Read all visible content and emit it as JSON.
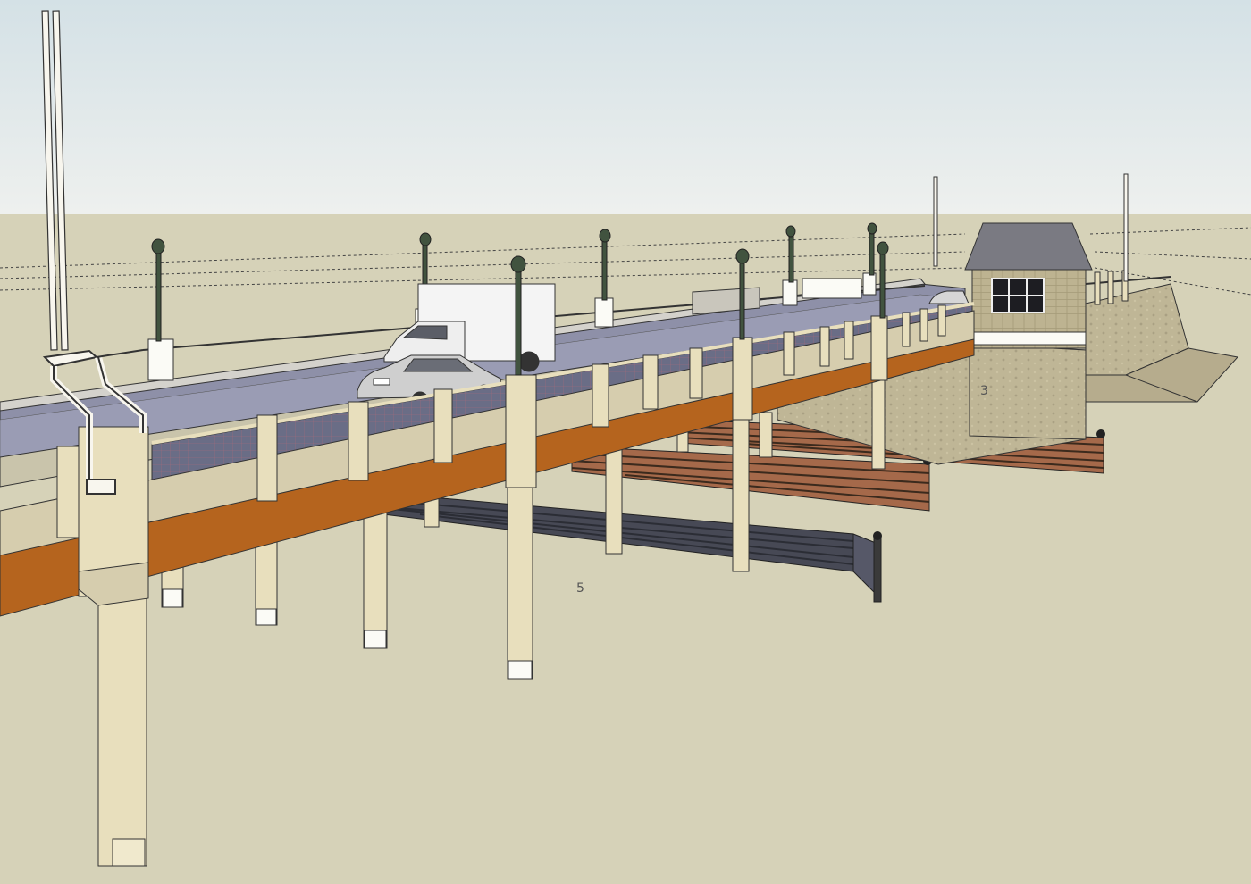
{
  "viewport": {
    "sky_color_top": "#d4e1e6",
    "sky_color_bottom": "#eef0ee",
    "ground_color": "#d6d2b8"
  },
  "model": {
    "dimension_labels": [
      {
        "id": "label-5",
        "text": "5"
      },
      {
        "id": "label-3",
        "text": "3"
      }
    ]
  },
  "materials": {
    "deck_road": "#8e90a8",
    "deck_side": "#a8795a",
    "girder": "#b5641e",
    "column": "#e8dfbd",
    "column_shadow": "#c9bf98",
    "fender_wood": "#a5694a",
    "fender_dark": "#3f3f46",
    "stone": "#b9b193",
    "roof": "#7a7a82",
    "lamp_post": "#41533f",
    "truck_box": "#f4f4f4",
    "car_body": "#cfcfcf"
  }
}
